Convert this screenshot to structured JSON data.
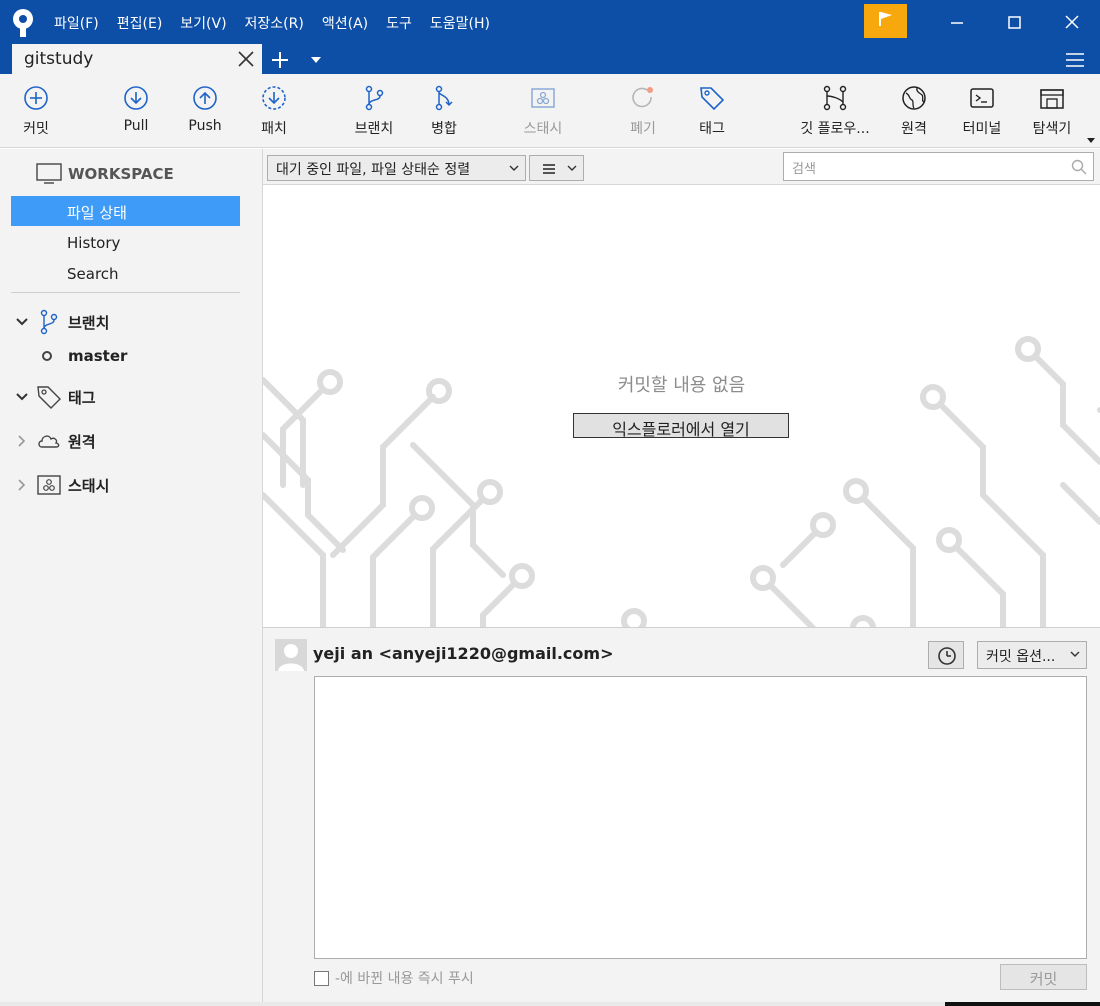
{
  "menu": [
    "파일(F)",
    "편집(E)",
    "보기(V)",
    "저장소(R)",
    "액션(A)",
    "도구",
    "도움말(H)"
  ],
  "tab": {
    "label": "gitstudy"
  },
  "toolbar": {
    "commit": "커밋",
    "pull": "Pull",
    "push": "Push",
    "patch": "패치",
    "branch": "브랜치",
    "merge": "병합",
    "stash": "스태시",
    "discard": "폐기",
    "tag": "태그",
    "gitflow": "깃 플로우...",
    "remote": "원격",
    "terminal": "터미널",
    "explorer": "탐색기"
  },
  "sidebar": {
    "workspace": "WORKSPACE",
    "items": [
      "파일 상태",
      "History",
      "Search"
    ],
    "branches": "브랜치",
    "current_branch": "master",
    "tags": "태그",
    "remotes": "원격",
    "stashes": "스태시"
  },
  "filter": {
    "selected": "대기 중인 파일, 파일 상태순 정렬",
    "search_placeholder": "검색"
  },
  "main": {
    "empty_text": "커밋할 내용 없음",
    "open_button": "익스플로러에서 열기"
  },
  "commit": {
    "author": "yeji an <anyeji1220@gmail.com>",
    "options": "커밋 옵션...",
    "push_label": "-에 바뀐 내용 즉시 푸시",
    "button": "커밋"
  },
  "colors": {
    "titlebar": "#0d4ea6",
    "accent": "#3e9bf8",
    "flag": "#f7a80d"
  }
}
